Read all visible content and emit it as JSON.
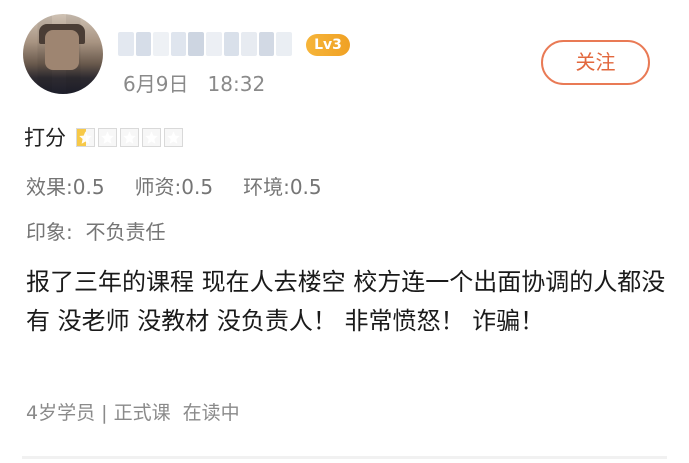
{
  "user": {
    "level": "Lv3",
    "date": "6月9日",
    "time": "18:32"
  },
  "follow_label": "关注",
  "rating": {
    "label": "打分",
    "value": 0.5,
    "max": 5
  },
  "scores": [
    {
      "label": "效果:0.5"
    },
    {
      "label": "师资:0.5"
    },
    {
      "label": "环境:0.5"
    }
  ],
  "impression": "印象:  不负责任",
  "review": "报了三年的课程 现在人去楼空 校方连一个出面协调的人都没有 没老师 没教材 没负责人！ 非常愤怒！ 诈骗！",
  "meta": "4岁学员 | 正式课  在读中",
  "colors": {
    "accent": "#e2683e",
    "badge": "#f6b53a",
    "star_fill": "#f7c948"
  }
}
